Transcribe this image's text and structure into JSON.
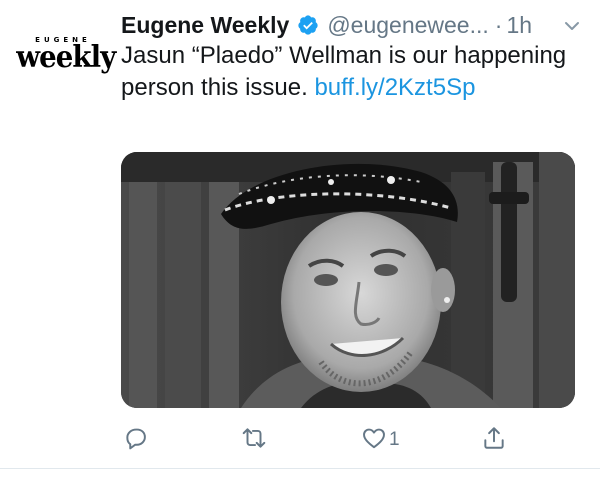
{
  "account": {
    "display_name": "Eugene Weekly",
    "handle": "@eugeneweekly",
    "handle_truncated": "@eugenewee...",
    "time": "1h",
    "separator": "·",
    "verified": true,
    "avatar": {
      "top_text": "EUGENE",
      "main_text": "weekly"
    }
  },
  "tweet": {
    "text": "Jasun “Plaedo” Wellman is our happening person this issue. ",
    "link": "buff.ly/2Kzt5Sp"
  },
  "media": {
    "type": "photo",
    "tone": "black-and-white"
  },
  "actions": {
    "reply": {
      "icon": "reply-icon",
      "count": ""
    },
    "retweet": {
      "icon": "retweet-icon",
      "count": ""
    },
    "like": {
      "icon": "heart-icon",
      "count": "1"
    },
    "share": {
      "icon": "share-icon",
      "count": ""
    }
  },
  "colors": {
    "link": "#1b95e0",
    "verified": "#1da1f2",
    "secondary_text": "#657786",
    "primary_text": "#14171a"
  }
}
